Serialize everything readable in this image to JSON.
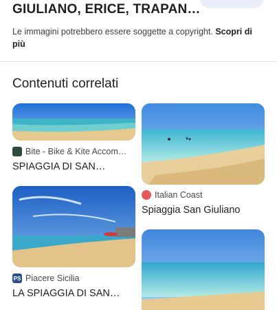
{
  "header": {
    "title": "GIULIANO, ERICE, TRAPAN…",
    "copyright_text": "Le immagini potrebbero essere soggette a copyright.",
    "copyright_link": "Scopri di più"
  },
  "section": {
    "title": "Contenuti correlati"
  },
  "results": [
    {
      "source": "Bite - Bike & Kite Accom…",
      "source_icon": "bite-favicon-icon",
      "caption": "SPIAGGIA DI SAN…"
    },
    {
      "source": "Italian Coast",
      "source_icon": "italian-coast-favicon-icon",
      "caption": "Spiaggia San Giuliano"
    },
    {
      "source": "Piacere Sicilia",
      "source_icon": "piacere-sicilia-favicon-icon",
      "source_icon_text": "PS",
      "caption": "LA SPIAGGIA DI SAN…"
    },
    {
      "source": "",
      "caption": ""
    }
  ],
  "colors": {
    "sky": "#4a90d9",
    "sea": "#7fd0e0",
    "sand": "#e9c98a"
  }
}
